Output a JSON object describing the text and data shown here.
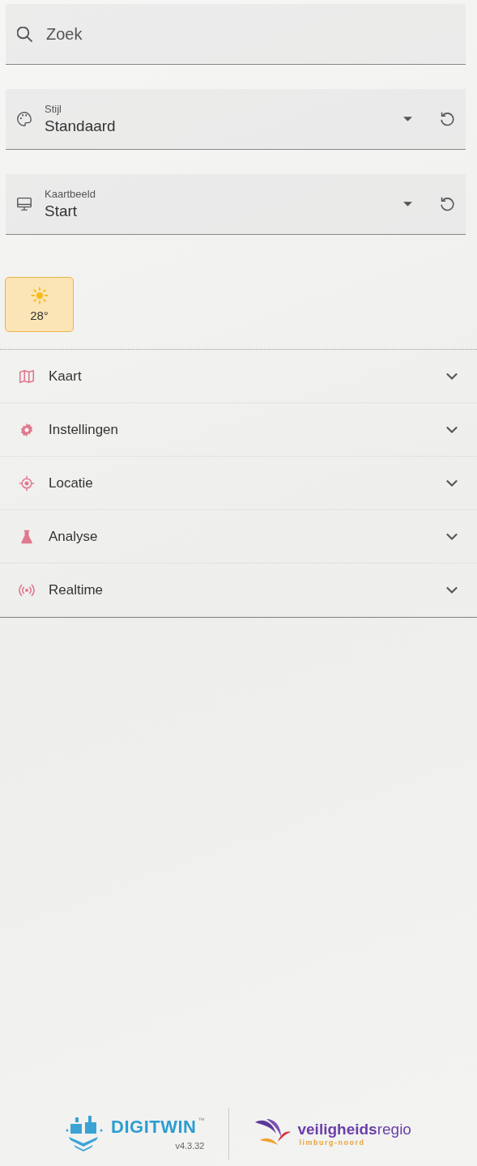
{
  "search": {
    "placeholder": "Zoek"
  },
  "selects": [
    {
      "kind": "style",
      "label": "Stijl",
      "value": "Standaard"
    },
    {
      "kind": "view",
      "label": "Kaartbeeld",
      "value": "Start"
    }
  ],
  "weather": {
    "temperature": "28°"
  },
  "menu": [
    {
      "kind": "map",
      "label": "Kaart",
      "expanded": false
    },
    {
      "kind": "settings",
      "label": "Instellingen",
      "expanded": false
    },
    {
      "kind": "location",
      "label": "Locatie",
      "expanded": false
    },
    {
      "kind": "analysis",
      "label": "Analyse",
      "expanded": false
    },
    {
      "kind": "realtime",
      "label": "Realtime",
      "expanded": false
    }
  ],
  "footer": {
    "product": "DIGITWIN",
    "trademark": "™",
    "version": "v4.3.32",
    "partner": "**veiligheids**regio",
    "partner_region": "limburg-noord"
  }
}
